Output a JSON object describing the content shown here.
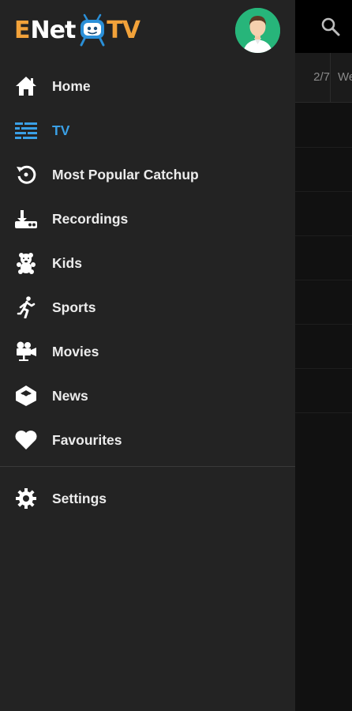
{
  "background": {
    "tabs": [
      "2/7",
      "We"
    ]
  },
  "header": {
    "logo": {
      "e": "E",
      "net": "Net",
      "tv": "TV"
    },
    "avatar_icon": "user-avatar"
  },
  "menu": {
    "items": [
      {
        "label": "Home",
        "icon": "home-icon",
        "active": false
      },
      {
        "label": "TV",
        "icon": "tv-guide-icon",
        "active": true
      },
      {
        "label": "Most Popular Catchup",
        "icon": "replay-icon",
        "active": false
      },
      {
        "label": "Recordings",
        "icon": "recording-icon",
        "active": false
      },
      {
        "label": "Kids",
        "icon": "teddy-bear-icon",
        "active": false
      },
      {
        "label": "Sports",
        "icon": "runner-icon",
        "active": false
      },
      {
        "label": "Movies",
        "icon": "movie-camera-icon",
        "active": false
      },
      {
        "label": "News",
        "icon": "news-icon",
        "active": false
      },
      {
        "label": "Favourites",
        "icon": "heart-icon",
        "active": false
      }
    ],
    "settings": {
      "label": "Settings",
      "icon": "gear-icon"
    }
  },
  "colors": {
    "accent": "#3aa0e6",
    "logo_orange": "#f2a23a",
    "drawer_bg": "#232323"
  }
}
